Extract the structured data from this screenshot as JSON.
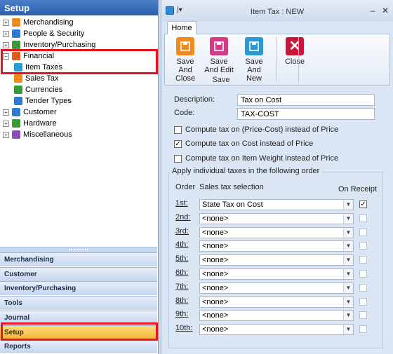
{
  "left_pane": {
    "header": "Setup",
    "tree": [
      {
        "label": "Merchandising",
        "expander": "+",
        "icon": "merchandising-icon",
        "color": "#f08a1c"
      },
      {
        "label": "People & Security",
        "expander": "+",
        "icon": "people-icon",
        "color": "#2e7bd1"
      },
      {
        "label": "Inventory/Purchasing",
        "expander": "+",
        "icon": "inventory-icon",
        "color": "#3a9a3a"
      },
      {
        "label": "Financial",
        "expander": "−",
        "icon": "financial-icon",
        "color": "#e05a1a"
      },
      {
        "label": "Item Taxes",
        "expander": "",
        "icon": "item-taxes-icon",
        "color": "#2a9ad6"
      },
      {
        "label": "Sales Tax",
        "expander": "",
        "icon": "sales-tax-icon",
        "color": "#f08a1c"
      },
      {
        "label": "Currencies",
        "expander": "",
        "icon": "currencies-icon",
        "color": "#3a9a3a"
      },
      {
        "label": "Tender Types",
        "expander": "",
        "icon": "tender-types-icon",
        "color": "#2e7bd1"
      },
      {
        "label": "Customer",
        "expander": "+",
        "icon": "customer-icon",
        "color": "#2e7bd1"
      },
      {
        "label": "Hardware",
        "expander": "+",
        "icon": "hardware-icon",
        "color": "#3a9a3a"
      },
      {
        "label": "Miscellaneous",
        "expander": "+",
        "icon": "miscellaneous-icon",
        "color": "#8a4fb8"
      }
    ],
    "nav_buttons": [
      "Merchandising",
      "Customer",
      "Inventory/Purchasing",
      "Tools",
      "Journal",
      "Setup",
      "Reports"
    ],
    "active_nav": "Setup"
  },
  "window": {
    "title": "Item Tax : NEW",
    "quick_access_symbol": "|▾",
    "minimize": "–",
    "close": "✕",
    "tab": "Home"
  },
  "ribbon": {
    "buttons": [
      {
        "label1": "Save And",
        "label2": "Close",
        "icon": "save-and-close-icon",
        "color": "#f08a1c"
      },
      {
        "label1": "Save",
        "label2": "And Edit",
        "icon": "save-and-edit-icon",
        "color": "#d63a86"
      },
      {
        "label1": "Save And",
        "label2": "New",
        "icon": "save-and-new-icon",
        "color": "#2a9ad6"
      },
      {
        "label1": "Close",
        "label2": "",
        "icon": "close-icon",
        "color": "#c8173a"
      }
    ],
    "group_label": "Save"
  },
  "form": {
    "description_label": "Description:",
    "description_value": "Tax on Cost",
    "code_label": "Code:",
    "code_value": "TAX-COST",
    "options": [
      {
        "label": "Compute tax on (Price-Cost) instead of Price",
        "checked": false
      },
      {
        "label": "Compute tax on Cost instead of Price",
        "checked": true
      },
      {
        "label": "Compute tax on Item Weight instead of Price",
        "checked": false
      }
    ],
    "group_title": "Apply individual taxes in the following order",
    "col_order": "Order",
    "col_selection": "Sales tax selection",
    "col_receipt": "On Receipt",
    "rows": [
      {
        "order": "1st:",
        "value": "State Tax on Cost",
        "on_receipt": true
      },
      {
        "order": "2nd:",
        "value": "<none>",
        "on_receipt": false
      },
      {
        "order": "3rd:",
        "value": "<none>",
        "on_receipt": false
      },
      {
        "order": "4th:",
        "value": "<none>",
        "on_receipt": false
      },
      {
        "order": "5th:",
        "value": "<none>",
        "on_receipt": false
      },
      {
        "order": "6th:",
        "value": "<none>",
        "on_receipt": false
      },
      {
        "order": "7th:",
        "value": "<none>",
        "on_receipt": false
      },
      {
        "order": "8th:",
        "value": "<none>",
        "on_receipt": false
      },
      {
        "order": "9th:",
        "value": "<none>",
        "on_receipt": false
      },
      {
        "order": "10th:",
        "value": "<none>",
        "on_receipt": false
      }
    ]
  }
}
